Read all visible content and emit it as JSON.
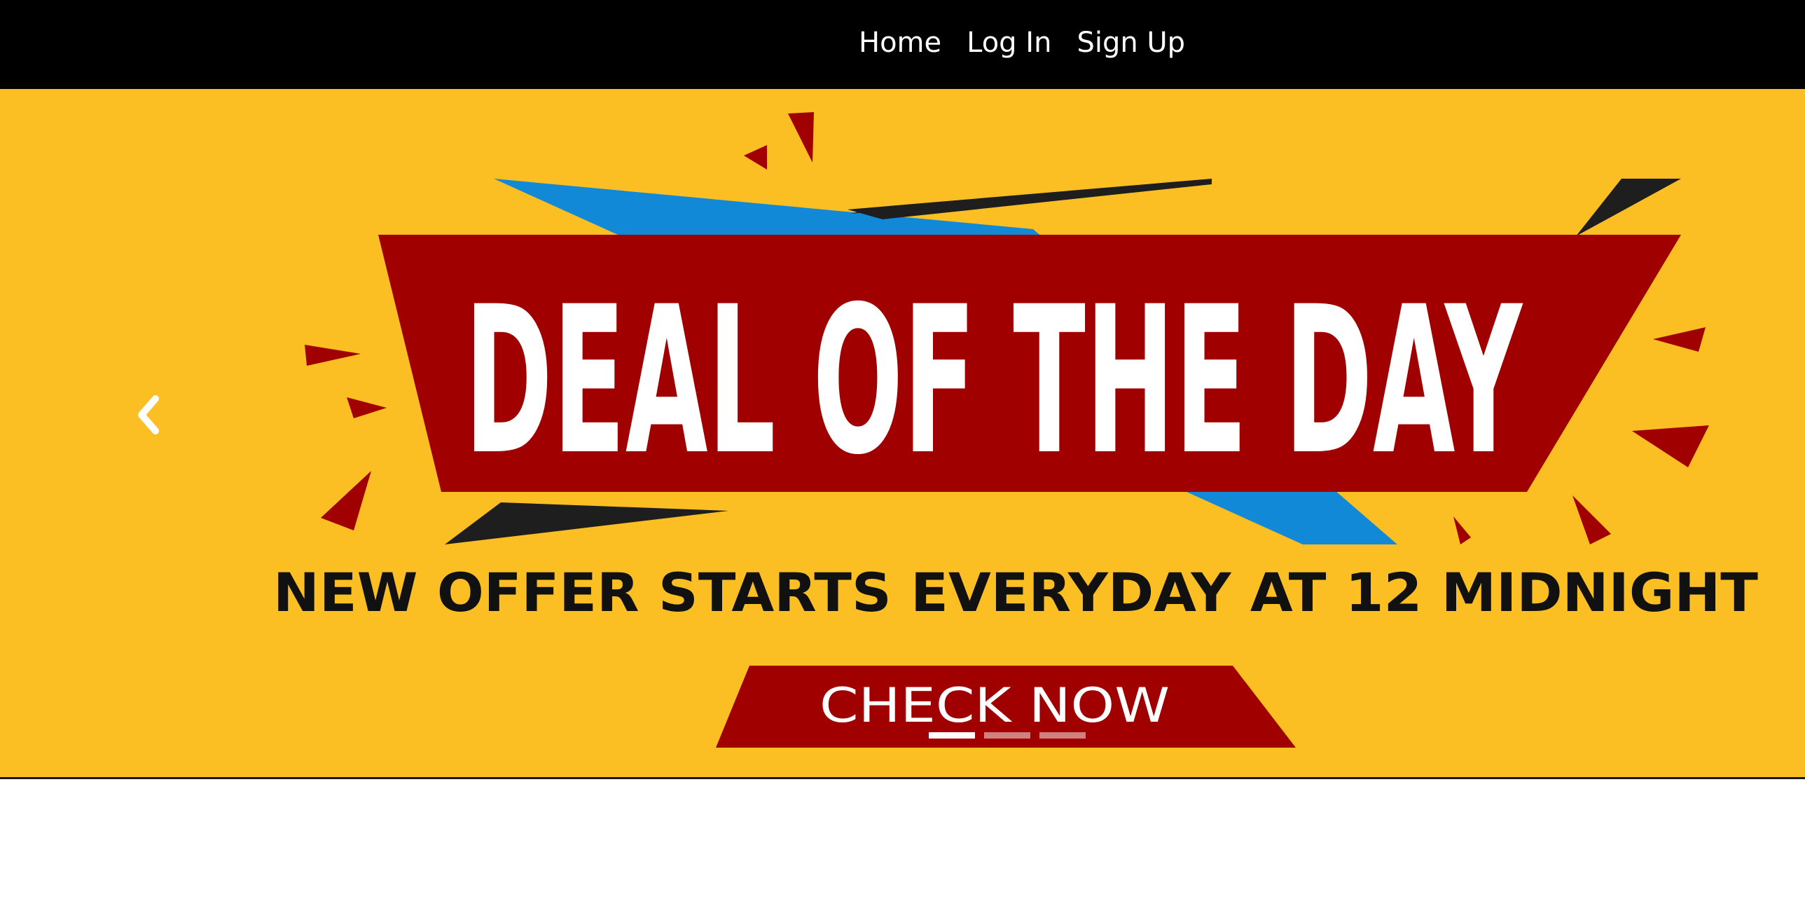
{
  "nav": {
    "links": [
      {
        "label": "Home"
      },
      {
        "label": "Log In"
      },
      {
        "label": "Sign Up"
      }
    ]
  },
  "banner": {
    "headline": "DEAL OF THE DAY",
    "subheadline": "NEW OFFER STARTS EVERYDAY AT 12 MIDNIGHT",
    "cta": "CHECK NOW"
  },
  "carousel": {
    "prev_icon": "chevron-left-icon",
    "indicator_count": 3,
    "active_index": 0
  },
  "colors": {
    "nav_bg": "#000000",
    "banner_bg": "#FBBF24",
    "banner_red": "#A00000",
    "banner_blue": "#1189D6",
    "banner_black": "#1E1E1E"
  }
}
